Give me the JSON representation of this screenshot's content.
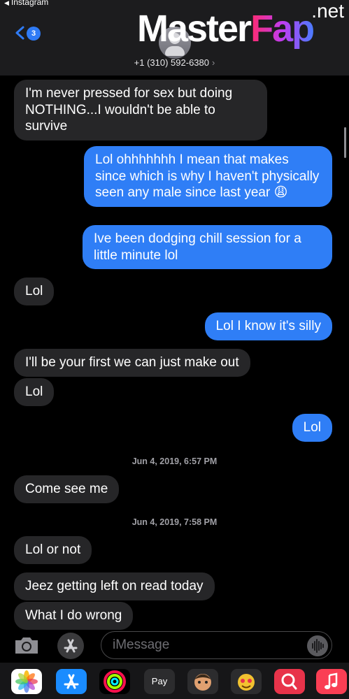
{
  "status": {
    "back_app": "Instagram",
    "back_glyph": "◀"
  },
  "header": {
    "unread_count": "3",
    "contact": "+1 (310) 592-6380",
    "contact_chevron": "›",
    "avatar_icon": "person-placeholder-icon"
  },
  "watermark": {
    "brand": "MasterFap",
    "brand_a": "Master",
    "brand_b": "Fap",
    "domain": ".net"
  },
  "thread": {
    "messages": [
      {
        "dir": "in",
        "text": "I'm never pressed for sex but doing NOTHING...I wouldn't be able to survive"
      },
      {
        "dir": "out",
        "text": "Lol ohhhhhhh I mean that makes since which is why I haven't physically seen any male since last year 😩"
      },
      {
        "dir": "out",
        "text": "Ive been dodging chill session for a little minute lol"
      },
      {
        "dir": "in",
        "text": "Lol"
      },
      {
        "dir": "out",
        "text": "Lol I know it's silly"
      },
      {
        "dir": "in",
        "text": "I'll be your first we can just make out"
      },
      {
        "dir": "in",
        "text": "Lol"
      },
      {
        "dir": "out",
        "text": "Lol"
      },
      {
        "dir": "in",
        "text": "Come see me"
      },
      {
        "dir": "in",
        "text": "Lol or not"
      },
      {
        "dir": "in",
        "text": "Jeez getting left on read today"
      },
      {
        "dir": "in",
        "text": "What I do wrong"
      }
    ],
    "timestamps": [
      "Jun 4, 2019, 6:57 PM",
      "Jun 4, 2019, 7:58 PM"
    ]
  },
  "composer": {
    "placeholder": "iMessage",
    "camera_icon": "camera-icon",
    "apps_icon": "app-store-icon",
    "audio_icon": "audio-waveform-icon"
  },
  "app_tray": {
    "items": [
      {
        "icon": "photos-icon",
        "label": "",
        "color": "#ffffff"
      },
      {
        "icon": "app-store-icon",
        "label": "",
        "color": "#1a8cff"
      },
      {
        "icon": "activity-icon",
        "label": "",
        "color": "#000000"
      },
      {
        "icon": "apple-pay-icon",
        "label": "Pay",
        "color": "#2c2c2e"
      },
      {
        "icon": "memoji-icon",
        "label": "",
        "color": "#2c2c2e"
      },
      {
        "icon": "animoji-icon",
        "label": "",
        "color": "#2c2c2e"
      },
      {
        "icon": "web-search-icon",
        "label": "",
        "color": "#e8334a"
      },
      {
        "icon": "music-icon",
        "label": "",
        "color": "#fa3e54"
      }
    ]
  },
  "colors": {
    "outgoing": "#2f7ef6",
    "incoming": "#262628",
    "background": "#000000"
  }
}
